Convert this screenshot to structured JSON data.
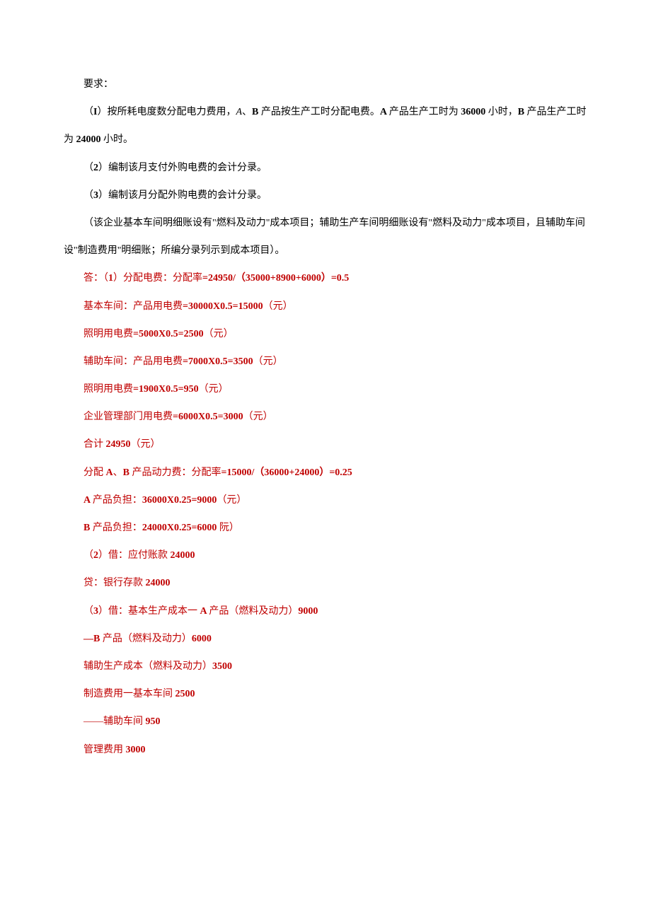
{
  "q_header": "要求：",
  "q_line1_pre": "（",
  "q_line1_num": "I",
  "q_line1_mid1": "）按所耗电度数分配电力费用，",
  "q_line1_a": "A",
  "q_line1_sep": "、",
  "q_line1_b": "B ",
  "q_line1_mid2": "产品按生产工时分配电费。",
  "q_line1_a2": "A ",
  "q_line1_mid3": "产品生产工时为 ",
  "q_line1_n1": "36000 ",
  "q_line1_mid4": "小时，",
  "q_line1_b2": "B ",
  "q_line1_end": "产品生产工时为 ",
  "q_line1_n2": "24000 ",
  "q_line1_end2": "小时。",
  "q_line2_pre": "（",
  "q_line2_num": "2",
  "q_line2_txt": "）编制该月支付外购电费的会计分录。",
  "q_line3_pre": "（",
  "q_line3_num": "3",
  "q_line3_txt": "）编制该月分配外购电费的会计分录。",
  "q_line4": "（该企业基本车间明细账设有\"燃料及动力\"成本项目；辅助生产车间明细账设有\"燃料及动力\"成本项目，且辅助车间设\"制造费用\"明细账；所编分录列示到成本项目）。",
  "a1_pre": "答：（",
  "a1_num": "1",
  "a1_mid": "）分配电费：分配率",
  "a1_calc": "=24950/（35000+8900+6000）=0.5",
  "a2_pre": "基本车间：产品用电费",
  "a2_calc": "=30000X0.5=15000",
  "a2_suf": "（元）",
  "a3_pre": "照明用电费",
  "a3_calc": "=5000X0.5=2500",
  "a3_suf": "（元）",
  "a4_pre": "辅助车间：产品用电费",
  "a4_calc": "=7000X0.5=3500",
  "a4_suf": "（元）",
  "a5_pre": "照明用电费",
  "a5_calc": "=1900X0.5=950",
  "a5_suf": "（元）",
  "a6_pre": "企业管理部门用电费",
  "a6_calc": "=6000X0.5=3000",
  "a6_suf": "（元）",
  "a7_pre": "合计 ",
  "a7_num": "24950",
  "a7_suf": "（元）",
  "a8_pre": "分配 ",
  "a8_a": "A",
  "a8_sep": "、",
  "a8_b": "B ",
  "a8_mid": "产品动力费：分配率",
  "a8_calc": "=15000/（36000+24000）=0.25",
  "a9_a": "A ",
  "a9_pre": "产品负担：",
  "a9_calc": "36000X0.25=9000",
  "a9_suf": "（元）",
  "a10_b": "B ",
  "a10_pre": "产品负担：",
  "a10_calc": "24000X0.25=6000 ",
  "a10_suf": "阮）",
  "a11_pre": "（",
  "a11_num": "2",
  "a11_mid": "）借：应付账款 ",
  "a11_val": "24000",
  "a12_pre": "贷：银行存款 ",
  "a12_val": "24000",
  "a13_pre": "（",
  "a13_num": "3",
  "a13_mid": "）借：基本生产成本一 ",
  "a13_a": "A ",
  "a13_mid2": "产品（燃料及动力）",
  "a13_val": "9000",
  "a14_dash": "—",
  "a14_b": "B ",
  "a14_mid": "产品（燃料及动力）",
  "a14_val": "6000",
  "a15_pre": "辅助生产成本（燃料及动力）",
  "a15_val": "3500",
  "a16_pre": "制造费用一基本车间 ",
  "a16_val": "2500",
  "a17_pre": "——辅助车间 ",
  "a17_val": "950",
  "a18_pre": "管理费用 ",
  "a18_val": "3000"
}
